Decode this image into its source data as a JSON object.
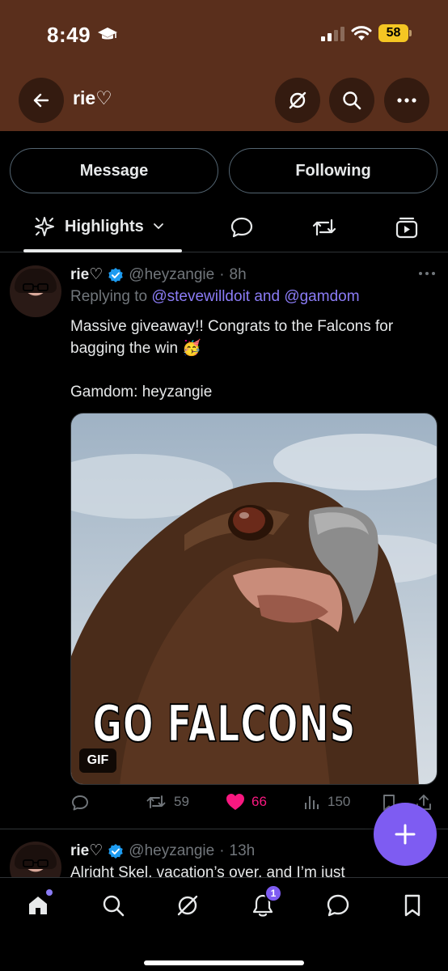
{
  "status_bar": {
    "time": "8:49",
    "battery": "58"
  },
  "header": {
    "title": "rie♡"
  },
  "profile_actions": {
    "message_label": "Message",
    "following_label": "Following"
  },
  "tabs": {
    "highlights_label": "Highlights"
  },
  "tweets": [
    {
      "name": "rie♡",
      "handle": "@heyzangie",
      "time": "8h",
      "replying_prefix": "Replying to",
      "mention_1": "@stevewilldoit",
      "mention_join": "and",
      "mention_2": "@gamdom",
      "text_line_1": "Massive giveaway!! Congrats to the Falcons for bagging the win 🥳",
      "text_line_2": "Gamdom: heyzangie",
      "media_caption": "GO FALCONS",
      "media_badge": "GIF",
      "stats": {
        "reposts": "59",
        "likes": "66",
        "views": "150"
      }
    },
    {
      "name": "rie♡",
      "handle": "@heyzangie",
      "time": "13h",
      "text_preview": "Alright Skel, vacation’s over, and I’m just"
    }
  ],
  "bottom_nav": {
    "notifications_count": "1"
  },
  "colors": {
    "header_bg": "#5a2f1c",
    "accent": "#7e5cf2",
    "mention": "#8b7cf6",
    "like": "#f91880",
    "verified": "#1d9bf0"
  }
}
